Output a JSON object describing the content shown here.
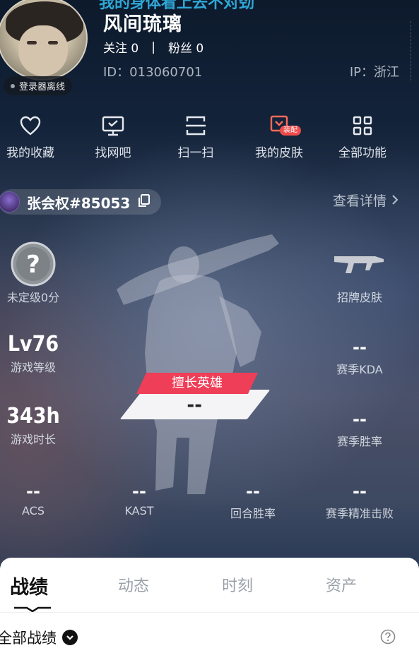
{
  "banner": {
    "text": "我的身体看上去不对劲"
  },
  "profile": {
    "name": "风间琉璃",
    "follow_label": "关注",
    "follow_count": "0",
    "separator": "|",
    "fans_label": "粉丝",
    "fans_count": "0",
    "id_text": "ID：013060701",
    "ip_text": "IP：浙江",
    "status": "登录器离线"
  },
  "quick_actions": [
    {
      "label": "我的收藏",
      "icon": "heart-icon"
    },
    {
      "label": "找网吧",
      "icon": "monitor-icon"
    },
    {
      "label": "扫一扫",
      "icon": "scan-icon"
    },
    {
      "label": "我的皮肤",
      "icon": "skin-icon",
      "badge": "装配"
    },
    {
      "label": "全部功能",
      "icon": "grid-icon"
    }
  ],
  "player": {
    "tag": "张会权#85053",
    "detail_link": "查看详情"
  },
  "stats": {
    "rank": {
      "label": "未定级0分"
    },
    "signature_skin": {
      "label": "招牌皮肤"
    },
    "level": {
      "value": "Lv76",
      "label": "游戏等级"
    },
    "season_kda": {
      "value": "--",
      "label": "赛季KDA"
    },
    "play_time": {
      "value": "343h",
      "label": "游戏时长"
    },
    "season_winrate": {
      "value": "--",
      "label": "赛季胜率"
    },
    "acs": {
      "value": "--",
      "label": "ACS"
    },
    "kast": {
      "value": "--",
      "label": "KAST"
    },
    "round_winrate": {
      "value": "--",
      "label": "回合胜率"
    },
    "season_precision": {
      "value": "--",
      "label": "赛季精准击败"
    }
  },
  "best_hero": {
    "tag": "擅长英雄",
    "value": "--"
  },
  "tabs": [
    {
      "label": "战绩",
      "active": true
    },
    {
      "label": "动态",
      "active": false
    },
    {
      "label": "时刻",
      "active": false
    },
    {
      "label": "资产",
      "active": false
    }
  ],
  "filter": {
    "label": "全部战绩"
  },
  "colors": {
    "accent_red": "#ef3e57",
    "banner_blue": "#2fa7d6",
    "panel_bg": "#ffffff"
  }
}
